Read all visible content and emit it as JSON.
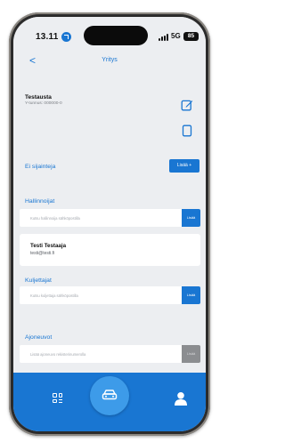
{
  "status_bar": {
    "time": "13.11",
    "network": "5G",
    "battery": "85"
  },
  "nav": {
    "back_symbol": "<",
    "title": "Yritys"
  },
  "company": {
    "name": "Testausta",
    "business_id": "Y-tunnus: 000000-0",
    "edit_icon": "edit-icon",
    "copy_icon": "copy-icon"
  },
  "locations": {
    "label": "Ei sijainteja",
    "add_button": "Lisää +"
  },
  "administrators": {
    "label": "Hallinnoijat",
    "search_placeholder": "Kutsu hallinnoija sähköpostilla",
    "search_button": "Lisää",
    "people": [
      {
        "name": "Testi Testaaja",
        "email": "testi@testi.fi"
      }
    ]
  },
  "drivers": {
    "label": "Kuljettajat",
    "search_placeholder": "Kutsu kuljettaja sähköpostilla",
    "search_button": "Lisää"
  },
  "vehicles": {
    "label": "Ajoneuvot",
    "search_placeholder": "Lisää ajoneuvo rekisterinumerolla",
    "search_button": "Lisää"
  },
  "tabbar": {
    "items": [
      {
        "icon": "grid-icon"
      },
      {
        "icon": "car-icon",
        "active": true
      },
      {
        "icon": "user-icon"
      }
    ],
    "color": "#1976d2",
    "active_color": "#3d9be9"
  }
}
